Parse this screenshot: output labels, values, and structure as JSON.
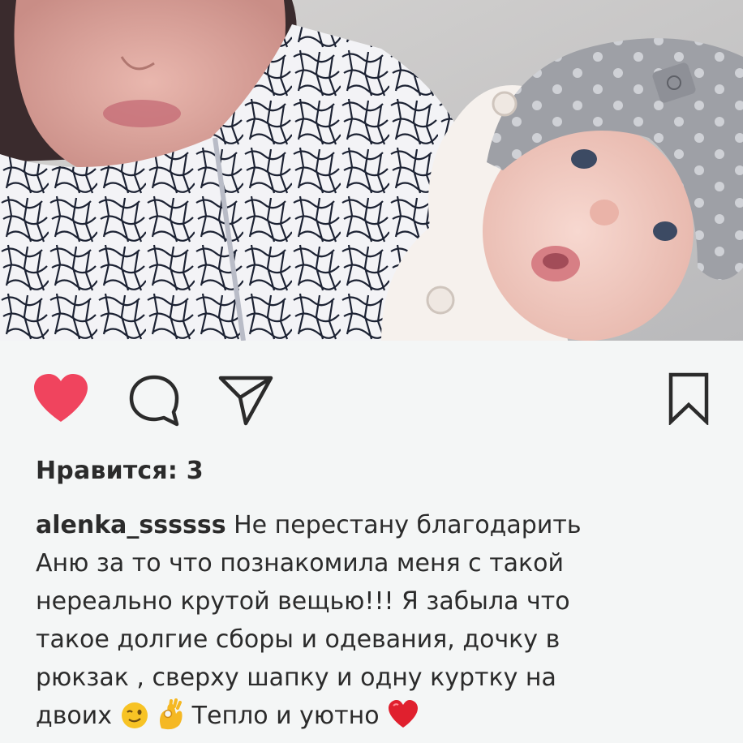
{
  "post": {
    "likes_text": "Нравится: 3",
    "username": "alenka_ssssss",
    "caption_lines": [
      "Не перестану благодарить",
      "Аню за то что познакомила меня с такой",
      "нереально крутой вещью!!! Я забыла что",
      "такое долгие сборы и одевания, дочку в",
      "рюкзак , сверху шапку и одну куртку на"
    ],
    "caption_last_a": "двоих",
    "caption_last_b": "Тепло и уютно",
    "liked": true
  },
  "icons": {
    "like": "heart-icon",
    "comment": "comment-bubble-icon",
    "share": "paper-plane-icon",
    "save": "bookmark-icon",
    "emoji_wink": "winking-face-emoji",
    "emoji_ok": "ok-hand-emoji",
    "emoji_heart": "red-heart-emoji"
  },
  "colors": {
    "like_active": "#f0445e",
    "text": "#2b2b2b",
    "icon_stroke": "#2b2b2b",
    "background": "#f4f6f6"
  }
}
